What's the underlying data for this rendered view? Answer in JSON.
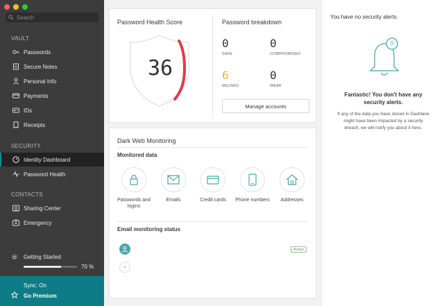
{
  "sidebar": {
    "search_placeholder": "Search",
    "sections": {
      "vault": "VAULT",
      "security": "SECURITY",
      "contacts": "CONTACTS"
    },
    "vault_items": [
      {
        "label": "Passwords",
        "icon": "key-icon"
      },
      {
        "label": "Secure Notes",
        "icon": "note-icon"
      },
      {
        "label": "Personal Info",
        "icon": "person-icon"
      },
      {
        "label": "Payments",
        "icon": "card-icon"
      },
      {
        "label": "IDs",
        "icon": "id-icon"
      },
      {
        "label": "Receipts",
        "icon": "receipt-icon"
      }
    ],
    "security_items": [
      {
        "label": "Identity Dashboard",
        "icon": "dashboard-icon",
        "active": true
      },
      {
        "label": "Password Health",
        "icon": "pulse-icon"
      }
    ],
    "contacts_items": [
      {
        "label": "Sharing Center",
        "icon": "sharing-icon"
      },
      {
        "label": "Emergency",
        "icon": "emergency-icon"
      }
    ],
    "getting_started": {
      "label": "Getting Started",
      "progress_label": "70 %",
      "progress": 0.7
    },
    "sync_label": "Sync: On",
    "premium_label": "Go Premium"
  },
  "health": {
    "title": "Password Health Score",
    "score": "36",
    "breakdown_title": "Password breakdown",
    "stats": [
      {
        "value": "0",
        "label": "SAFE"
      },
      {
        "value": "0",
        "label": "COMPROMISED"
      },
      {
        "value": "6",
        "label": "REUSED"
      },
      {
        "value": "0",
        "label": "WEAK"
      }
    ],
    "manage_label": "Manage accounts"
  },
  "dark_web": {
    "title": "Dark Web Monitoring",
    "monitored_title": "Monitored data",
    "items": [
      {
        "label": "Passwords and logins",
        "icon": "lock-icon"
      },
      {
        "label": "Emails",
        "icon": "mail-icon"
      },
      {
        "label": "Credit cards",
        "icon": "credit-card-icon"
      },
      {
        "label": "Phone numbers",
        "icon": "phone-icon"
      },
      {
        "label": "Addresses",
        "icon": "home-icon"
      }
    ],
    "email_status_title": "Email monitoring status",
    "email_badge": "Active"
  },
  "alerts": {
    "title": "You have no security alerts",
    "badge_count": "0",
    "headline": "Fantastic! You don't have any security alerts.",
    "body": "If any of the data you have stored in Dashlane might have been impacted by a security breach, we will notify you about it here."
  },
  "colors": {
    "sidebar_bg": "#3c3c3c",
    "accent_teal": "#0e7c86",
    "score_arc": "#e3384b",
    "reused_value": "#e8b83a",
    "active_badge": "#4e9a4a"
  }
}
